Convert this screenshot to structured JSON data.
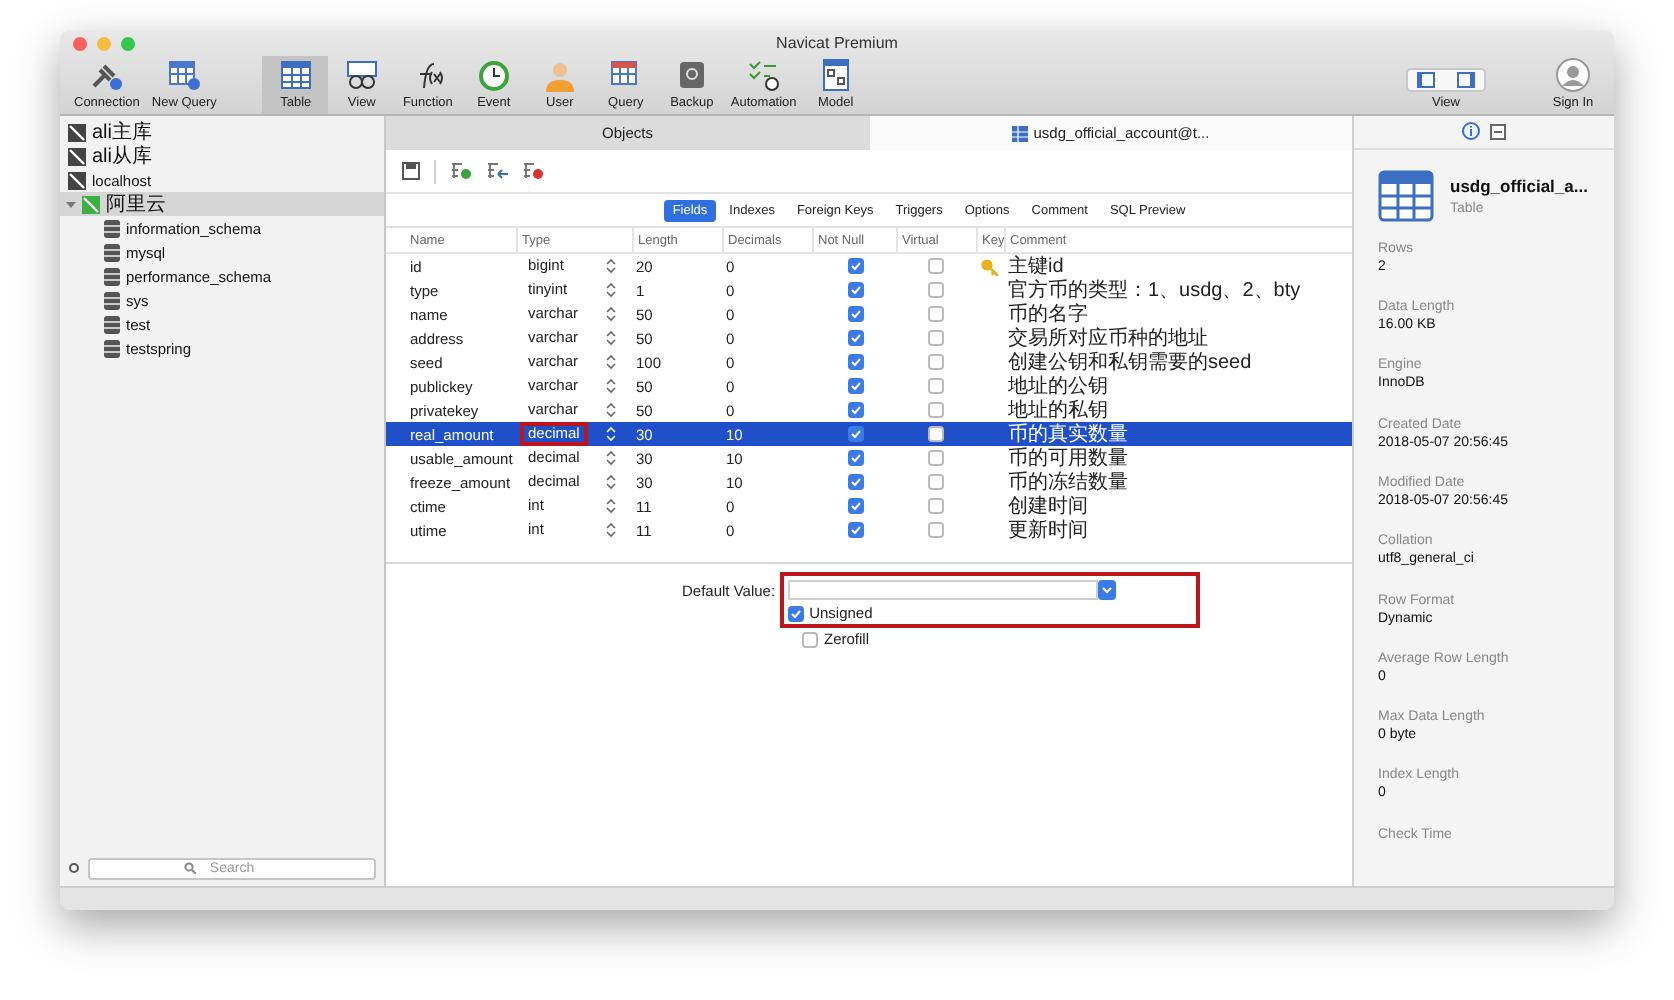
{
  "window": {
    "title": "Navicat Premium"
  },
  "toolbar": [
    {
      "kind": "connection",
      "label": "Connection",
      "selected": false
    },
    {
      "kind": "newquery",
      "label": "New Query",
      "selected": false
    },
    {
      "kind": "table",
      "label": "Table",
      "selected": true
    },
    {
      "kind": "view",
      "label": "View",
      "selected": false
    },
    {
      "kind": "function",
      "label": "Function",
      "selected": false
    },
    {
      "kind": "event",
      "label": "Event",
      "selected": false
    },
    {
      "kind": "user",
      "label": "User",
      "selected": false
    },
    {
      "kind": "query",
      "label": "Query",
      "selected": false
    },
    {
      "kind": "backup",
      "label": "Backup",
      "selected": false
    },
    {
      "kind": "automation",
      "label": "Automation",
      "selected": false
    },
    {
      "kind": "model",
      "label": "Model",
      "selected": false
    }
  ],
  "view_toggle": {
    "label": "View"
  },
  "sign_in": {
    "label": "Sign In"
  },
  "sidebar": {
    "items": [
      {
        "label": "ali主库",
        "connected": false,
        "selected": false
      },
      {
        "label": "ali从库",
        "connected": false,
        "selected": false
      },
      {
        "label": "localhost",
        "connected": false,
        "selected": false
      },
      {
        "label": "阿里云",
        "connected": true,
        "selected": true,
        "expanded": true,
        "children": [
          {
            "label": "information_schema"
          },
          {
            "label": "mysql"
          },
          {
            "label": "performance_schema"
          },
          {
            "label": "sys"
          },
          {
            "label": "test"
          },
          {
            "label": "testspring"
          }
        ]
      }
    ],
    "search": {
      "placeholder": "Search"
    }
  },
  "doc_tabs": [
    {
      "label": "Objects",
      "selected": false
    },
    {
      "label": "usdg_official_account@t...",
      "selected": true
    }
  ],
  "sub_tabs": [
    {
      "label": "Fields",
      "selected": true
    },
    {
      "label": "Indexes",
      "selected": false
    },
    {
      "label": "Foreign Keys",
      "selected": false
    },
    {
      "label": "Triggers",
      "selected": false
    },
    {
      "label": "Options",
      "selected": false
    },
    {
      "label": "Comment",
      "selected": false
    },
    {
      "label": "SQL Preview",
      "selected": false
    }
  ],
  "table": {
    "columns": [
      "Name",
      "Type",
      "Length",
      "Decimals",
      "Not Null",
      "Virtual",
      "Key",
      "Comment"
    ],
    "rows": [
      {
        "name": "id",
        "type": "bigint",
        "length": "20",
        "decimals": "0",
        "not_null": true,
        "virtual": false,
        "key": true,
        "comment": "主键id",
        "selected": false,
        "type_highlighted": false
      },
      {
        "name": "type",
        "type": "tinyint",
        "length": "1",
        "decimals": "0",
        "not_null": true,
        "virtual": false,
        "key": false,
        "comment": "官方币的类型：1、usdg、2、bty",
        "selected": false,
        "type_highlighted": false
      },
      {
        "name": "name",
        "type": "varchar",
        "length": "50",
        "decimals": "0",
        "not_null": true,
        "virtual": false,
        "key": false,
        "comment": "币的名字",
        "selected": false,
        "type_highlighted": false
      },
      {
        "name": "address",
        "type": "varchar",
        "length": "50",
        "decimals": "0",
        "not_null": true,
        "virtual": false,
        "key": false,
        "comment": "交易所对应币种的地址",
        "selected": false,
        "type_highlighted": false
      },
      {
        "name": "seed",
        "type": "varchar",
        "length": "100",
        "decimals": "0",
        "not_null": true,
        "virtual": false,
        "key": false,
        "comment": "创建公钥和私钥需要的seed",
        "selected": false,
        "type_highlighted": false
      },
      {
        "name": "publickey",
        "type": "varchar",
        "length": "50",
        "decimals": "0",
        "not_null": true,
        "virtual": false,
        "key": false,
        "comment": "地址的公钥",
        "selected": false,
        "type_highlighted": false
      },
      {
        "name": "privatekey",
        "type": "varchar",
        "length": "50",
        "decimals": "0",
        "not_null": true,
        "virtual": false,
        "key": false,
        "comment": "地址的私钥",
        "selected": false,
        "type_highlighted": false
      },
      {
        "name": "real_amount",
        "type": "decimal",
        "length": "30",
        "decimals": "10",
        "not_null": true,
        "virtual": false,
        "key": false,
        "comment": "币的真实数量",
        "selected": true,
        "type_highlighted": true
      },
      {
        "name": "usable_amount",
        "type": "decimal",
        "length": "30",
        "decimals": "10",
        "not_null": true,
        "virtual": false,
        "key": false,
        "comment": "币的可用数量",
        "selected": false,
        "type_highlighted": false
      },
      {
        "name": "freeze_amount",
        "type": "decimal",
        "length": "30",
        "decimals": "10",
        "not_null": true,
        "virtual": false,
        "key": false,
        "comment": "币的冻结数量",
        "selected": false,
        "type_highlighted": false
      },
      {
        "name": "ctime",
        "type": "int",
        "length": "11",
        "decimals": "0",
        "not_null": true,
        "virtual": false,
        "key": false,
        "comment": "创建时间",
        "selected": false,
        "type_highlighted": false
      },
      {
        "name": "utime",
        "type": "int",
        "length": "11",
        "decimals": "0",
        "not_null": true,
        "virtual": false,
        "key": false,
        "comment": "更新时间",
        "selected": false,
        "type_highlighted": false
      }
    ]
  },
  "field_options": {
    "default_value_label": "Default Value:",
    "highlighted": true,
    "checkboxes": [
      {
        "label": "Unsigned",
        "checked": true
      },
      {
        "label": "Zerofill",
        "checked": false
      }
    ]
  },
  "info": {
    "name": "usdg_official_a...",
    "subtitle": "Table",
    "properties": [
      {
        "label": "Rows",
        "value": "2"
      },
      {
        "label": "Data Length",
        "value": "16.00 KB"
      },
      {
        "label": "Engine",
        "value": "InnoDB"
      },
      {
        "label": "Created Date",
        "value": "2018-05-07 20:56:45"
      },
      {
        "label": "Modified Date",
        "value": "2018-05-07 20:56:45"
      },
      {
        "label": "Collation",
        "value": "utf8_general_ci"
      },
      {
        "label": "Row Format",
        "value": "Dynamic"
      },
      {
        "label": "Average Row Length",
        "value": "0"
      },
      {
        "label": "Max Data Length",
        "value": "0 byte"
      },
      {
        "label": "Index Length",
        "value": "0"
      },
      {
        "label": "Check Time"
      }
    ]
  }
}
